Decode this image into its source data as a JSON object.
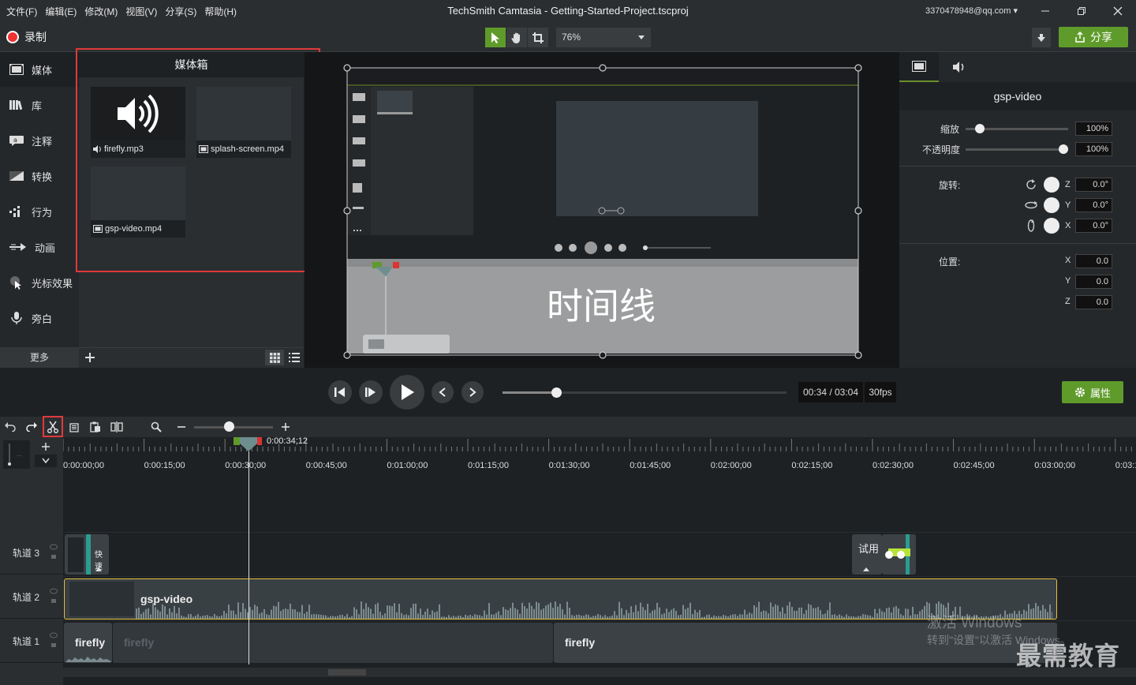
{
  "menu": [
    "文件(F)",
    "编辑(E)",
    "修改(M)",
    "视图(V)",
    "分享(S)",
    "帮助(H)"
  ],
  "window_title": "TechSmith Camtasia - Getting-Started-Project.tscproj",
  "account": "3370478948@qq.com",
  "record_label": "录制",
  "zoom_level": "76%",
  "share_label": "分享",
  "sidebar": [
    {
      "label": "媒体",
      "icon": "film-icon",
      "active": true
    },
    {
      "label": "库",
      "icon": "library-icon"
    },
    {
      "label": "注释",
      "icon": "annotation-icon"
    },
    {
      "label": "转换",
      "icon": "transition-icon"
    },
    {
      "label": "行为",
      "icon": "behavior-icon"
    },
    {
      "label": "动画",
      "icon": "animation-icon"
    },
    {
      "label": "光标效果",
      "icon": "cursor-icon"
    },
    {
      "label": "旁白",
      "icon": "microphone-icon"
    }
  ],
  "sidebar_more": "更多",
  "media_bin": {
    "title": "媒体箱",
    "items": [
      {
        "name": "firefly.mp3",
        "kind": "audio"
      },
      {
        "name": "splash-screen.mp4",
        "kind": "video"
      },
      {
        "name": "gsp-video.mp4",
        "kind": "video"
      }
    ]
  },
  "canvas_overlay_text": "时间线",
  "properties": {
    "clip_name": "gsp-video",
    "scale_label": "缩放",
    "scale_value": "100%",
    "scale_fraction": 0.1,
    "opacity_label": "不透明度",
    "opacity_value": "100%",
    "opacity_fraction": 1.0,
    "rotation_label": "旋转:",
    "rotation": [
      {
        "axis": "Z",
        "value": "0.0°"
      },
      {
        "axis": "Y",
        "value": "0.0°"
      },
      {
        "axis": "X",
        "value": "0.0°"
      }
    ],
    "position_label": "位置:",
    "position": [
      {
        "axis": "X",
        "value": "0.0"
      },
      {
        "axis": "Y",
        "value": "0.0"
      },
      {
        "axis": "Z",
        "value": "0.0"
      }
    ]
  },
  "playback": {
    "time": "00:34 / 03:04",
    "fps": "30fps",
    "progress_fraction": 0.19,
    "properties_label": "属性"
  },
  "timeline": {
    "playhead_time": "0:00:34;12",
    "ticks": [
      "0:00:00;00",
      "0:00:15;00",
      "0:00:30;00",
      "0:00:45;00",
      "0:01:00;00",
      "0:01:15;00",
      "0:01:30;00",
      "0:01:45;00",
      "0:02:00;00",
      "0:02:15;00",
      "0:02:30;00",
      "0:02:45;00",
      "0:03:00;00",
      "0:03:1"
    ],
    "tracks": [
      "轨道 3",
      "轨道 2",
      "轨道 1"
    ],
    "clips": {
      "track3_a": "快速",
      "track3_b": "试用",
      "track2": "gsp-video",
      "track1": [
        "firefly",
        "firefly",
        "firefly"
      ]
    }
  },
  "watermark": {
    "line1": "激活 Windows",
    "line2": "转到\"设置\"以激活 Windows。",
    "brand": "最需教育"
  },
  "colors": {
    "accent": "#5f9b2a",
    "highlight": "#e03a3a",
    "clip_border": "#e5c13a"
  }
}
